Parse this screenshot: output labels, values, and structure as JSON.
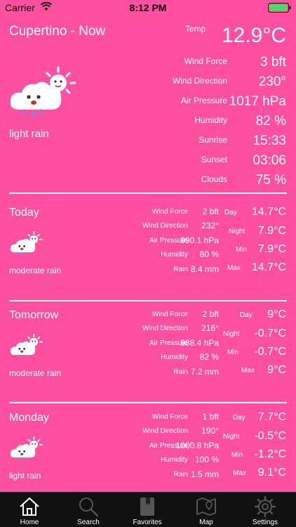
{
  "status": {
    "carrier": "Carrier",
    "time": "8:12 PM"
  },
  "now": {
    "title": "Cupertino - Now",
    "description": "light rain",
    "temp_label": "Temp",
    "temp_value": "12.9°C",
    "details": [
      {
        "label": "Wind Force",
        "value": "3 bft"
      },
      {
        "label": "Wind Direction",
        "value": "230°"
      },
      {
        "label": "Air Pressure",
        "value": "1017 hPa"
      },
      {
        "label": "Humidity",
        "value": "82 %"
      },
      {
        "label": "Sunrise",
        "value": "15:33"
      },
      {
        "label": "Sunset",
        "value": "03:06"
      },
      {
        "label": "Clouds",
        "value": "75 %"
      }
    ]
  },
  "forecast": [
    {
      "name": "Today",
      "description": "moderate rain",
      "details": [
        {
          "label": "Wind Force",
          "value": "2 bft"
        },
        {
          "label": "Wind Direction",
          "value": "232°"
        },
        {
          "label": "Air Pressure",
          "value": "990.1 hPa"
        },
        {
          "label": "Humidity",
          "value": "80 %"
        },
        {
          "label": "Rain",
          "value": "8.4 mm"
        }
      ],
      "temps": [
        {
          "label": "Day",
          "value": "14.7°C"
        },
        {
          "label": "Night",
          "value": "7.9°C"
        },
        {
          "label": "Min",
          "value": "7.9°C"
        },
        {
          "label": "Max",
          "value": "14.7°C"
        }
      ]
    },
    {
      "name": "Tomorrow",
      "description": "moderate rain",
      "details": [
        {
          "label": "Wind Force",
          "value": "2 bft"
        },
        {
          "label": "Wind Direction",
          "value": "216°"
        },
        {
          "label": "Air Pressure",
          "value": "988.4 hPa"
        },
        {
          "label": "Humidity",
          "value": "82 %"
        },
        {
          "label": "Rain",
          "value": "7.2 mm"
        }
      ],
      "temps": [
        {
          "label": "Day",
          "value": "9°C"
        },
        {
          "label": "Night",
          "value": "-0.7°C"
        },
        {
          "label": "Min",
          "value": "-0.7°C"
        },
        {
          "label": "Max",
          "value": "9°C"
        }
      ]
    },
    {
      "name": "Monday",
      "description": "light rain",
      "details": [
        {
          "label": "Wind Force",
          "value": "1 bft"
        },
        {
          "label": "Wind Direction",
          "value": "190°"
        },
        {
          "label": "Air Pressure",
          "value": "1000.8 hPa"
        },
        {
          "label": "Humidity",
          "value": "100 %"
        },
        {
          "label": "Rain",
          "value": "1.5 mm"
        }
      ],
      "temps": [
        {
          "label": "Day",
          "value": "7.7°C"
        },
        {
          "label": "Night",
          "value": "-0.5°C"
        },
        {
          "label": "Min",
          "value": "-1.2°C"
        },
        {
          "label": "Max",
          "value": "9.1°C"
        }
      ]
    }
  ],
  "tabs": [
    {
      "label": "Home",
      "icon": "home-icon"
    },
    {
      "label": "Search",
      "icon": "search-icon"
    },
    {
      "label": "Favorites",
      "icon": "favorites-icon"
    },
    {
      "label": "Map",
      "icon": "map-icon"
    },
    {
      "label": "Settings",
      "icon": "settings-icon"
    }
  ],
  "colors": {
    "background": "#ff4fa0",
    "tabbar": "#111111",
    "battery": "#4cd964"
  }
}
